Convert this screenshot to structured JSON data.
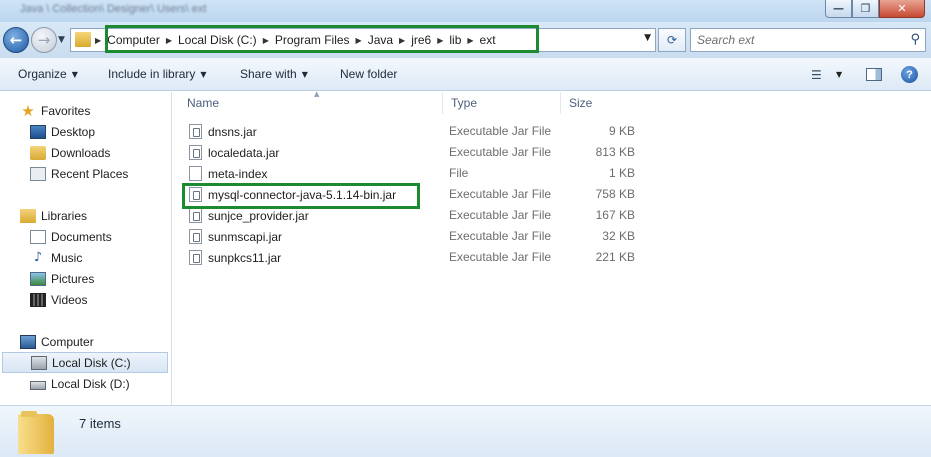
{
  "window": {
    "title": "Java \\ Collection\\ Designer\\ Users\\ ext",
    "controls": {
      "minimize": "—",
      "maximize": "❐",
      "close": "✕"
    }
  },
  "navigation": {
    "back_icon": "back-arrow-icon",
    "forward_icon": "forward-arrow-icon",
    "breadcrumb": [
      "Computer",
      "Local Disk (C:)",
      "Program Files",
      "Java",
      "jre6",
      "lib",
      "ext"
    ],
    "search_placeholder": "Search ext"
  },
  "toolbar": {
    "organize": "Organize",
    "include_in_library": "Include in library",
    "share_with": "Share with",
    "new_folder": "New folder"
  },
  "sidebar": {
    "favorites": {
      "label": "Favorites",
      "items": [
        "Desktop",
        "Downloads",
        "Recent Places"
      ]
    },
    "libraries": {
      "label": "Libraries",
      "items": [
        "Documents",
        "Music",
        "Pictures",
        "Videos"
      ]
    },
    "computer": {
      "label": "Computer",
      "items": [
        "Local Disk (C:)",
        "Local Disk (D:)"
      ],
      "selected": "Local Disk (C:)"
    }
  },
  "columns": {
    "name": "Name",
    "type": "Type",
    "size": "Size"
  },
  "files": [
    {
      "name": "dnsns.jar",
      "type": "Executable Jar File",
      "size": "9 KB"
    },
    {
      "name": "localedata.jar",
      "type": "Executable Jar File",
      "size": "813 KB"
    },
    {
      "name": "meta-index",
      "type": "File",
      "size": "1 KB"
    },
    {
      "name": "mysql-connector-java-5.1.14-bin.jar",
      "type": "Executable Jar File",
      "size": "758 KB"
    },
    {
      "name": "sunjce_provider.jar",
      "type": "Executable Jar File",
      "size": "167 KB"
    },
    {
      "name": "sunmscapi.jar",
      "type": "Executable Jar File",
      "size": "32 KB"
    },
    {
      "name": "sunpkcs11.jar",
      "type": "Executable Jar File",
      "size": "221 KB"
    }
  ],
  "status": {
    "item_count": "7 items"
  },
  "colors": {
    "highlight_box": "#1c8a2e",
    "accent": "#1d5aa5"
  }
}
